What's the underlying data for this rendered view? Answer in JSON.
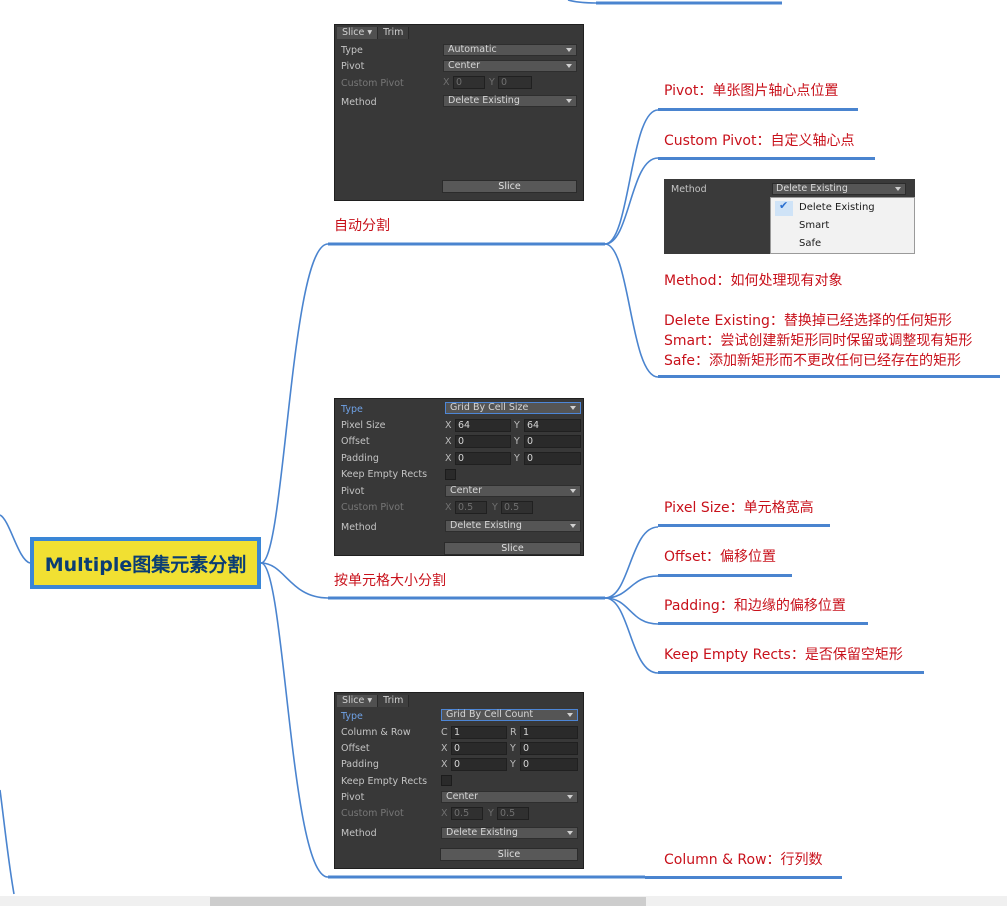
{
  "root": {
    "title": "Multiple图集元素分割"
  },
  "branches": {
    "auto": "自动分割",
    "cellsize": "按单元格大小分割"
  },
  "auto_notes": {
    "pivot": "Pivot：单张图片轴心点位置",
    "custom_pivot": "Custom Pivot：自定义轴心点",
    "method": "Method：如何处理现有对象",
    "delete_existing": "Delete Existing：替换掉已经选择的任何矩形",
    "smart": "Smart：尝试创建新矩形同时保留或调整现有矩形",
    "safe": "Safe：添加新矩形而不更改任何已经存在的矩形"
  },
  "cellsize_notes": {
    "pixel_size": "Pixel Size：单元格宽高",
    "offset": "Offset：偏移位置",
    "padding": "Padding：和边缘的偏移位置",
    "keep_empty": "Keep Empty Rects：是否保留空矩形"
  },
  "cellcount_notes": {
    "column_row": "Column & Row：行列数"
  },
  "panel_auto": {
    "tab_slice": "Slice ▾",
    "tab_trim": "Trim",
    "type_label": "Type",
    "type_value": "Automatic",
    "pivot_label": "Pivot",
    "pivot_value": "Center",
    "custom_pivot_label": "Custom Pivot",
    "x": "X",
    "x_val": "0",
    "y": "Y",
    "y_val": "0",
    "method_label": "Method",
    "method_value": "Delete Existing",
    "slice_button": "Slice"
  },
  "panel_cellsize": {
    "type_label": "Type",
    "type_value": "Grid By Cell Size",
    "pixel_size_label": "Pixel Size",
    "px": "X",
    "px_val": "64",
    "py": "Y",
    "py_val": "64",
    "offset_label": "Offset",
    "ox": "X",
    "ox_val": "0",
    "oy": "Y",
    "oy_val": "0",
    "padding_label": "Padding",
    "pdx": "X",
    "pdx_val": "0",
    "pdy": "Y",
    "pdy_val": "0",
    "keep_empty_label": "Keep Empty Rects",
    "pivot_label": "Pivot",
    "pivot_value": "Center",
    "custom_pivot_label": "Custom Pivot",
    "cx": "X",
    "cx_val": "0.5",
    "cy": "Y",
    "cy_val": "0.5",
    "method_label": "Method",
    "method_value": "Delete Existing",
    "slice_button": "Slice"
  },
  "panel_cellcount": {
    "tab_slice": "Slice ▾",
    "tab_trim": "Trim",
    "type_label": "Type",
    "type_value": "Grid By Cell Count",
    "column_row_label": "Column & Row",
    "c": "C",
    "c_val": "1",
    "r": "R",
    "r_val": "1",
    "offset_label": "Offset",
    "ox": "X",
    "ox_val": "0",
    "oy": "Y",
    "oy_val": "0",
    "padding_label": "Padding",
    "pdx": "X",
    "pdx_val": "0",
    "pdy": "Y",
    "pdy_val": "0",
    "keep_empty_label": "Keep Empty Rects",
    "pivot_label": "Pivot",
    "pivot_value": "Center",
    "custom_pivot_label": "Custom Pivot",
    "cx": "X",
    "cx_val": "0.5",
    "cy": "Y",
    "cy_val": "0.5",
    "method_label": "Method",
    "method_value": "Delete Existing",
    "slice_button": "Slice"
  },
  "method_popup": {
    "label": "Method",
    "value": "Delete Existing",
    "options": [
      "Delete Existing",
      "Smart",
      "Safe"
    ]
  },
  "colors": {
    "root_fill": "#f1e032",
    "root_border": "#3a86d6",
    "root_text": "#0a3d74",
    "node_text": "#c8111b",
    "link": "#4a84cf",
    "panel_bg": "#383838"
  }
}
